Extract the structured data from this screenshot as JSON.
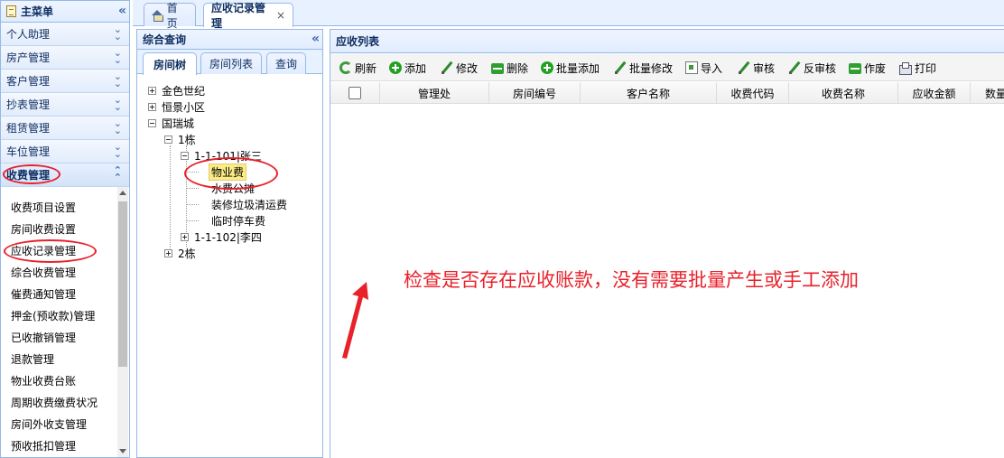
{
  "left_menu": {
    "title": "主菜单",
    "items": [
      {
        "label": "个人助理"
      },
      {
        "label": "房产管理"
      },
      {
        "label": "客户管理"
      },
      {
        "label": "抄表管理"
      },
      {
        "label": "租赁管理"
      },
      {
        "label": "车位管理"
      },
      {
        "label": "收费管理",
        "expanded": true
      }
    ],
    "sub_items": [
      "收费项目设置",
      "房间收费设置",
      "应收记录管理",
      "综合收费管理",
      "催费通知管理",
      "押金(预收款)管理",
      "已收撤销管理",
      "退款管理",
      "物业收费台账",
      "周期收费缴费状况",
      "房间外收支管理",
      "预收抵扣管理"
    ]
  },
  "top_tabs": [
    {
      "label": "首页",
      "icon": "home-icon"
    },
    {
      "label": "应收记录管理",
      "active": true
    }
  ],
  "query_panel": {
    "title": "综合查询",
    "tabs": [
      "房间树",
      "房间列表",
      "查询"
    ],
    "tree": {
      "nodes": [
        "金色世纪",
        "恒景小区",
        "国瑞城",
        "1栋",
        "1-1-101|张三",
        "物业费",
        "水费公摊",
        "装修垃圾清运费",
        "临时停车费",
        "1-1-102|李四",
        "2栋"
      ]
    }
  },
  "list_panel": {
    "title": "应收列表",
    "toolbar": [
      "刷新",
      "添加",
      "修改",
      "删除",
      "批量添加",
      "批量修改",
      "导入",
      "审核",
      "反审核",
      "作废",
      "打印"
    ],
    "columns": [
      "管理处",
      "房间编号",
      "客户名称",
      "收费代码",
      "收费名称",
      "应收金额",
      "数量"
    ]
  },
  "annotation": "检查是否存在应收账款，没有需要批量产生或手工添加",
  "colors": {
    "annotation": "#e8212b",
    "border": "#95b8e7",
    "header_text": "#0e2d5f"
  }
}
